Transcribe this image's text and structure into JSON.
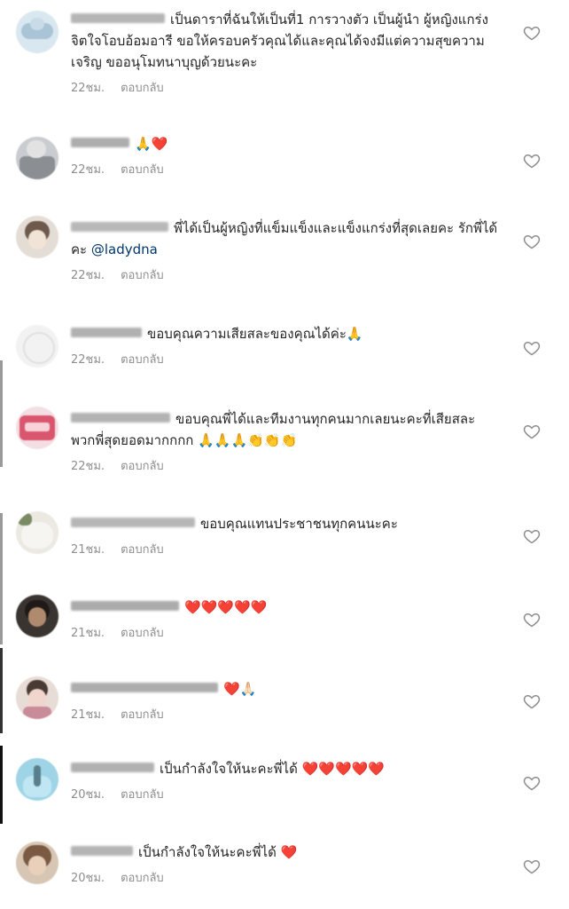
{
  "comments": [
    {
      "text": "เป็นดาราที่ฉันให้เป็นที่1 การวางตัว เป็นผู้นำ ผู้หญิงแกร่ง จิตใจโอบอ้อมอารี ขอให้ครอบครัวคุณได้และคุณได้จงมีแต่ความสุขความเจริญ  ขออนุโมทนาบุญด้วยนะคะ",
      "time": "22ชม.",
      "reply": "ตอบกลับ"
    },
    {
      "text": "🙏❤️",
      "time": "22ชม.",
      "reply": "ตอบกลับ"
    },
    {
      "text": "พี่ได้เป็นผู้หญิงที่แข็มแข็งและแข็งแกร่งที่สุดเลยคะ รักพี่ได้คะ",
      "mention": "@ladydna",
      "time": "22ชม.",
      "reply": "ตอบกลับ"
    },
    {
      "text": "ขอบคุณความเสียสละของคุณได้ค่ะ🙏",
      "time": "22ชม.",
      "reply": "ตอบกลับ"
    },
    {
      "text": "ขอบคุณพี่ได้และทีมงานทุกคนมากเลยนะคะที่เสียสละ พวกพี่สุดยอดมากกกก 🙏🙏🙏👏👏👏",
      "time": "22ชม.",
      "reply": "ตอบกลับ"
    },
    {
      "text": "ขอบคุณแทนประชาชนทุกคนนะคะ",
      "time": "21ชม.",
      "reply": "ตอบกลับ"
    },
    {
      "text": "❤️❤️❤️❤️❤️",
      "time": "21ชม.",
      "reply": "ตอบกลับ"
    },
    {
      "text": "❤️🙏🏻",
      "time": "21ชม.",
      "reply": "ตอบกลับ"
    },
    {
      "text": "เป็นกำลังใจให้นะคะพี่ได้ ❤️❤️❤️❤️❤️",
      "time": "20ชม.",
      "reply": "ตอบกลับ"
    },
    {
      "text": "เป็นกำลังใจให้นะคะพี่ได้ ❤️",
      "time": "20ชม.",
      "reply": "ตอบกลับ"
    }
  ],
  "colors": {
    "text": "#262626",
    "meta": "#8e8e8e",
    "mention": "#00376b",
    "heart_outline": "#8e8e8e"
  },
  "icons": {
    "like": "heart-outline-icon"
  }
}
